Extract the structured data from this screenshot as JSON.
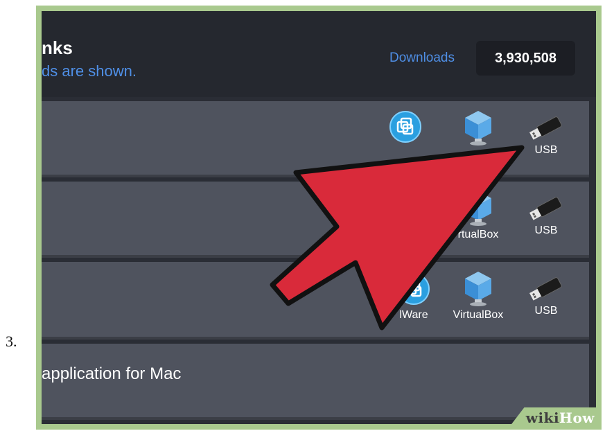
{
  "step": "3.",
  "header": {
    "title": "nks",
    "subtitle": "ds are shown.",
    "downloads_label": "Downloads",
    "downloads_count": "3,930,508"
  },
  "rows": [
    {
      "label": "",
      "options": [
        {
          "label": "",
          "icon": "vmware-icon"
        },
        {
          "label": "",
          "icon": "virtualbox-icon"
        },
        {
          "label": "USB",
          "icon": "usb-drive-icon"
        }
      ]
    },
    {
      "label": "",
      "options": [
        {
          "label": "rtualBox",
          "icon": "virtualbox-icon"
        },
        {
          "label": "USB",
          "icon": "usb-drive-icon"
        }
      ]
    },
    {
      "label": "",
      "options": [
        {
          "label": "lWare",
          "icon": "vmware-icon"
        },
        {
          "label": "VirtualBox",
          "icon": "virtualbox-icon"
        },
        {
          "label": "USB",
          "icon": "usb-drive-icon"
        }
      ]
    },
    {
      "label": "application for Mac",
      "options": []
    }
  ],
  "overlay": {
    "icon": "red-arrow-icon",
    "color": "#d92a3a"
  },
  "watermark": {
    "part1": "wiki",
    "part2": "How"
  },
  "colors": {
    "link": "#4f8fe6",
    "row_bg": "#4f535e",
    "frame": "#a9c98e"
  }
}
